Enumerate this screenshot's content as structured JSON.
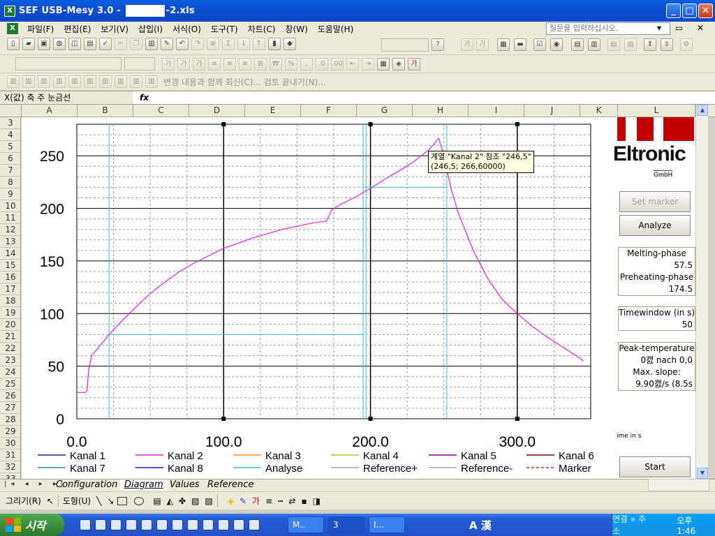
{
  "window": {
    "title_prefix": "SEF USB-Mesy 3.0 - ",
    "title_suffix": "-2.xls"
  },
  "menu": {
    "items": [
      "파일(F)",
      "편집(E)",
      "보기(V)",
      "삽입(I)",
      "서식(O)",
      "도구(T)",
      "차트(C)",
      "창(W)",
      "도움말(H)"
    ],
    "ask_placeholder": "질문을 입력하십시오."
  },
  "toolbar3": {
    "review_text": "변경 내용과 함께 회신(C)...  검토 끝내기(N)..."
  },
  "formula": {
    "namebox": "X(값) 축 주 눈금선",
    "fx": "fx"
  },
  "columns": [
    "A",
    "B",
    "C",
    "D",
    "E",
    "F",
    "G",
    "H",
    "I",
    "J",
    "K",
    "L"
  ],
  "rows": [
    "3",
    "4",
    "5",
    "6",
    "7",
    "8",
    "9",
    "10",
    "11",
    "12",
    "13",
    "14",
    "15",
    "16",
    "17",
    "18",
    "19",
    "20",
    "21",
    "22",
    "23",
    "24",
    "25",
    "26",
    "27",
    "28",
    "29",
    "30",
    "31",
    "32",
    "33"
  ],
  "panel": {
    "set_marker": "Set marker",
    "analyze": "Analyze",
    "melting_label": "Melting-phase",
    "melting_value": "57.5",
    "preheat_label": "Preheating-phase",
    "preheat_value": "174.5",
    "timewindow_label": "Timewindow (in s)",
    "timewindow_value": "50",
    "peak_label": "Peak-temperature",
    "peak_value": "0캜 nach 0,0",
    "slope_label": "Max. slope:",
    "slope_value": "9.90캜/s (8.5s",
    "time_label": "ime in s",
    "start": "Start"
  },
  "logo": {
    "text": "Eltronic",
    "sub": "GmbH"
  },
  "tooltip": {
    "line1": "계열 \"Kanal 2\" 참조 \"246,5\"",
    "line2": "(246,5; 266,60000)"
  },
  "tabs": [
    "Configuration",
    "Diagram",
    "Values",
    "Reference"
  ],
  "drawbar": {
    "draw": "그리기(R)",
    "shapes": "도형(U)"
  },
  "taskbar": {
    "start": "시작",
    "tasks": [
      "M..",
      "3",
      "I..."
    ],
    "ime": "A 漢",
    "tray_text": "연결  » 주소",
    "clock": "오후 1:46"
  },
  "colors": {
    "kanal2": "#e020e0",
    "analyse": "#40c0d0",
    "grid": "#000000"
  },
  "chart_data": {
    "type": "line",
    "xlim": [
      0,
      350
    ],
    "ylim": [
      0,
      280
    ],
    "xticks": [
      0,
      100,
      200,
      300
    ],
    "xtick_labels": [
      "0.0",
      "100.0",
      "200.0",
      "300.0"
    ],
    "yticks": [
      0,
      50,
      100,
      150,
      200,
      250
    ],
    "ytick_labels": [
      "0",
      "50",
      "100",
      "150",
      "200",
      "250"
    ],
    "series": [
      {
        "name": "Kanal 2",
        "color": "#e020e0",
        "x": [
          0,
          6,
          7,
          8,
          10,
          15,
          22,
          30,
          40,
          50,
          60,
          70,
          80,
          90,
          100,
          110,
          120,
          130,
          140,
          150,
          160,
          170,
          172,
          174,
          180,
          190,
          200,
          210,
          220,
          230,
          240,
          246.5,
          250,
          255,
          260,
          270,
          280,
          290,
          300,
          310,
          320,
          330,
          340,
          345
        ],
        "y": [
          25,
          25,
          27,
          45,
          60,
          68,
          80,
          92,
          106,
          119,
          130,
          140,
          148,
          155,
          162,
          167,
          172,
          176,
          180,
          183,
          186,
          188,
          194,
          199,
          204,
          211,
          219,
          228,
          236,
          245,
          256,
          266.6,
          250,
          218,
          195,
          160,
          133,
          113,
          100,
          88,
          78,
          69,
          60,
          55
        ]
      },
      {
        "name": "Analyse",
        "color": "#40c0d0",
        "segments": [
          [
            [
              22,
              80
            ],
            [
              196,
              80
            ]
          ],
          [
            [
              196,
              220
            ],
            [
              252,
              220
            ]
          ]
        ],
        "vlines": [
          22,
          195,
          197,
          252
        ]
      }
    ],
    "legend": [
      "Kanal 1",
      "Kanal 2",
      "Kanal 3",
      "Kanal 4",
      "Kanal 5",
      "Kanal 6",
      "Kanal 7",
      "Kanal 8",
      "Analyse",
      "Reference+",
      "Reference-",
      "Marker"
    ],
    "legend_colors": [
      "#1c2a8a",
      "#e020e0",
      "#ff9020",
      "#9acd32",
      "#800080",
      "#8b0000",
      "#2a8aa8",
      "#1a1ae0",
      "#40c0d0",
      "#a0a0a0",
      "#a0a0a0",
      "#e02020"
    ],
    "legend_placement": "bottom"
  }
}
